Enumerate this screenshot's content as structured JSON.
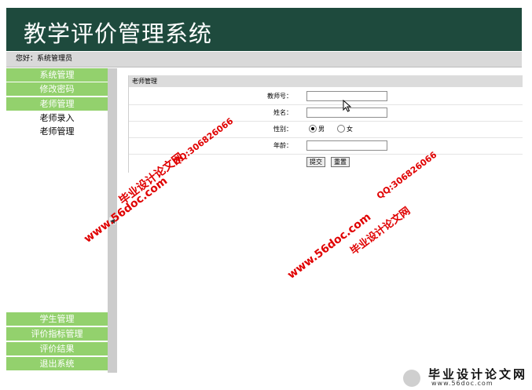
{
  "header": {
    "title": "教学评价管理系统"
  },
  "welcome": "您好：系统管理员",
  "sidebar": {
    "top_items": [
      "系统管理",
      "修改密码",
      "老师管理"
    ],
    "sub_items": [
      "老师录入",
      "老师管理"
    ],
    "bottom_items": [
      "学生管理",
      "评价指标管理",
      "评价结果",
      "退出系统"
    ]
  },
  "panel": {
    "title": "老师管理",
    "fields": {
      "teacher_no_label": "教师号：",
      "name_label": "姓名：",
      "gender_label": "性别：",
      "gender_male": "男",
      "gender_female": "女",
      "age_label": "年龄："
    },
    "submit_label": "提交",
    "reset_label": "重置"
  },
  "watermarks": {
    "site": "www.56doc.com",
    "qq": "QQ:306826066",
    "brand": "毕业设计论文网"
  },
  "footer_logo": {
    "title": "毕业设计论文网",
    "url": "www.56doc.com"
  },
  "colors": {
    "header_bg": "#1e4a3d",
    "nav_green": "#93d16d",
    "watermark_red": "#e00000"
  }
}
